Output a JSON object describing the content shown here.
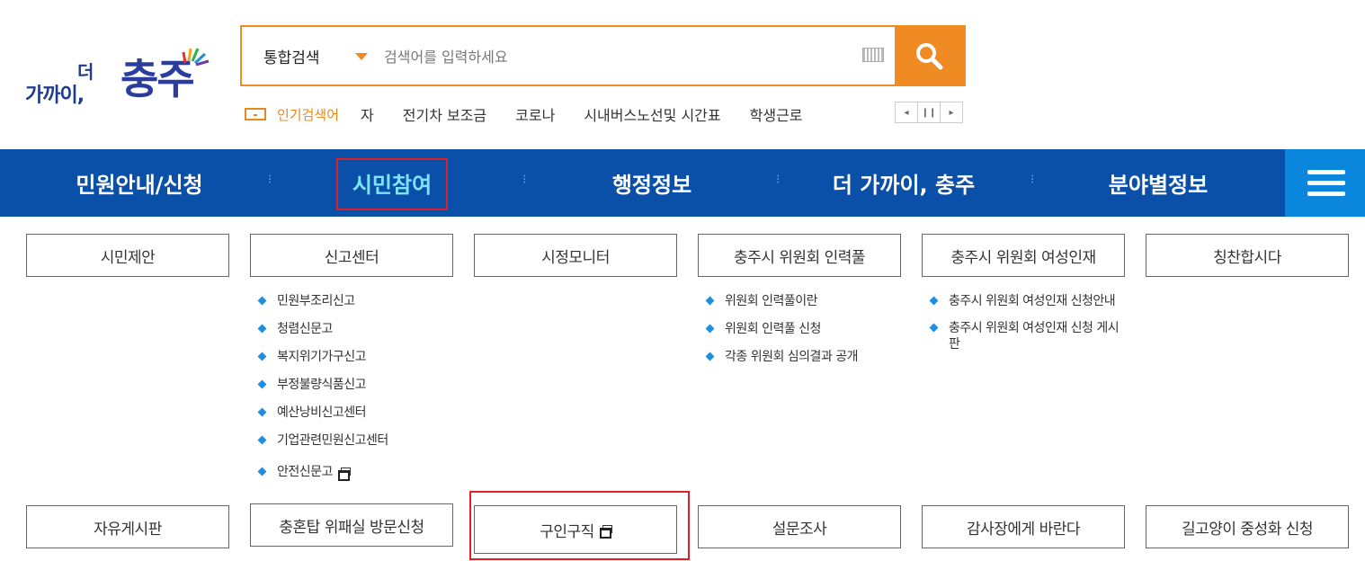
{
  "logo": {
    "small_text": "가까이,",
    "deo_text": "더",
    "big_text": "충주"
  },
  "search": {
    "scope_label": "통합검색",
    "placeholder": "검색어를 입력하세요"
  },
  "popular": {
    "title": "인기검색어",
    "keywords": [
      "자",
      "전기차 보조금",
      "코로나",
      "시내버스노선및 시간표",
      "학생근로"
    ]
  },
  "rolling": {
    "prev": "◂",
    "pause": "❙❙",
    "next": "▸"
  },
  "nav": {
    "items": [
      "민원안내/신청",
      "시민참여",
      "행정정보",
      "더 가까이, 충주",
      "분야별정보"
    ],
    "active": "시민참여"
  },
  "submenu": {
    "row1": [
      "시민제안",
      "신고센터",
      "시정모니터",
      "충주시 위원회 인력풀",
      "충주시 위원회 여성인재",
      "칭찬합시다"
    ],
    "row2": [
      "자유게시판",
      "충혼탑 위패실 방문신청",
      "구인구직",
      "설문조사",
      "감사장에게 바란다",
      "길고양이 중성화 신청"
    ],
    "report_center_items": [
      "민원부조리신고",
      "청렴신문고",
      "복지위기가구신고",
      "부정불량식품신고",
      "예산낭비신고센터",
      "기업관련민원신고센터",
      "안전신문고"
    ],
    "pool_items": [
      "위원회 인력풀이란",
      "위원회 인력풀 신청",
      "각종 위원회 심의결과 공개"
    ],
    "women_items": [
      "충주시 위원회 여성인재 신청안내",
      "충주시 위원회 여성인재 신청 게시판"
    ]
  },
  "colors": {
    "nav_bg": "#0a4fa8",
    "accent": "#f08a22",
    "active_text": "#7fe3ff",
    "highlight": "#e21f26"
  }
}
